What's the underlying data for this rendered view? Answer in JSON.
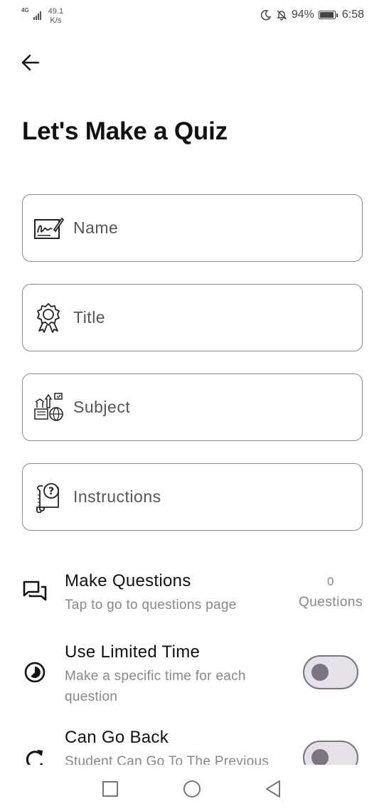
{
  "status_bar": {
    "network_type": "4G",
    "speed_value": "49.1",
    "speed_unit": "K/s",
    "battery": "94%",
    "time": "6:58",
    "icons": [
      "moon-icon",
      "bell-off-icon",
      "battery-icon"
    ]
  },
  "header": {
    "back_icon": "arrow-left-icon",
    "title": "Let's Make a Quiz"
  },
  "fields": [
    {
      "label": "Name",
      "icon": "signature-icon"
    },
    {
      "label": "Title",
      "icon": "award-ribbon-icon"
    },
    {
      "label": "Subject",
      "icon": "subjects-icon"
    },
    {
      "label": "Instructions",
      "icon": "question-scroll-icon"
    }
  ],
  "options": {
    "make_questions": {
      "title": "Make Questions",
      "subtitle": "Tap to go to questions page",
      "count": "0",
      "count_label": "Questions",
      "icon": "chat-bubbles-icon"
    },
    "limited_time": {
      "title": "Use Limited Time",
      "subtitle": "Make a specific time for each question",
      "enabled": false,
      "icon": "timer-icon"
    },
    "go_back": {
      "title": "Can Go Back",
      "subtitle": "Student Can Go To The Previous",
      "enabled": false,
      "icon": "refresh-icon"
    }
  },
  "nav_bar": {
    "icons": [
      "recents-square-icon",
      "home-circle-icon",
      "back-triangle-icon"
    ]
  },
  "colors": {
    "toggle_track": "#e6e0e9",
    "toggle_border": "#7a747e",
    "toggle_knob": "#79747e",
    "field_border": "#8a8a8a"
  }
}
